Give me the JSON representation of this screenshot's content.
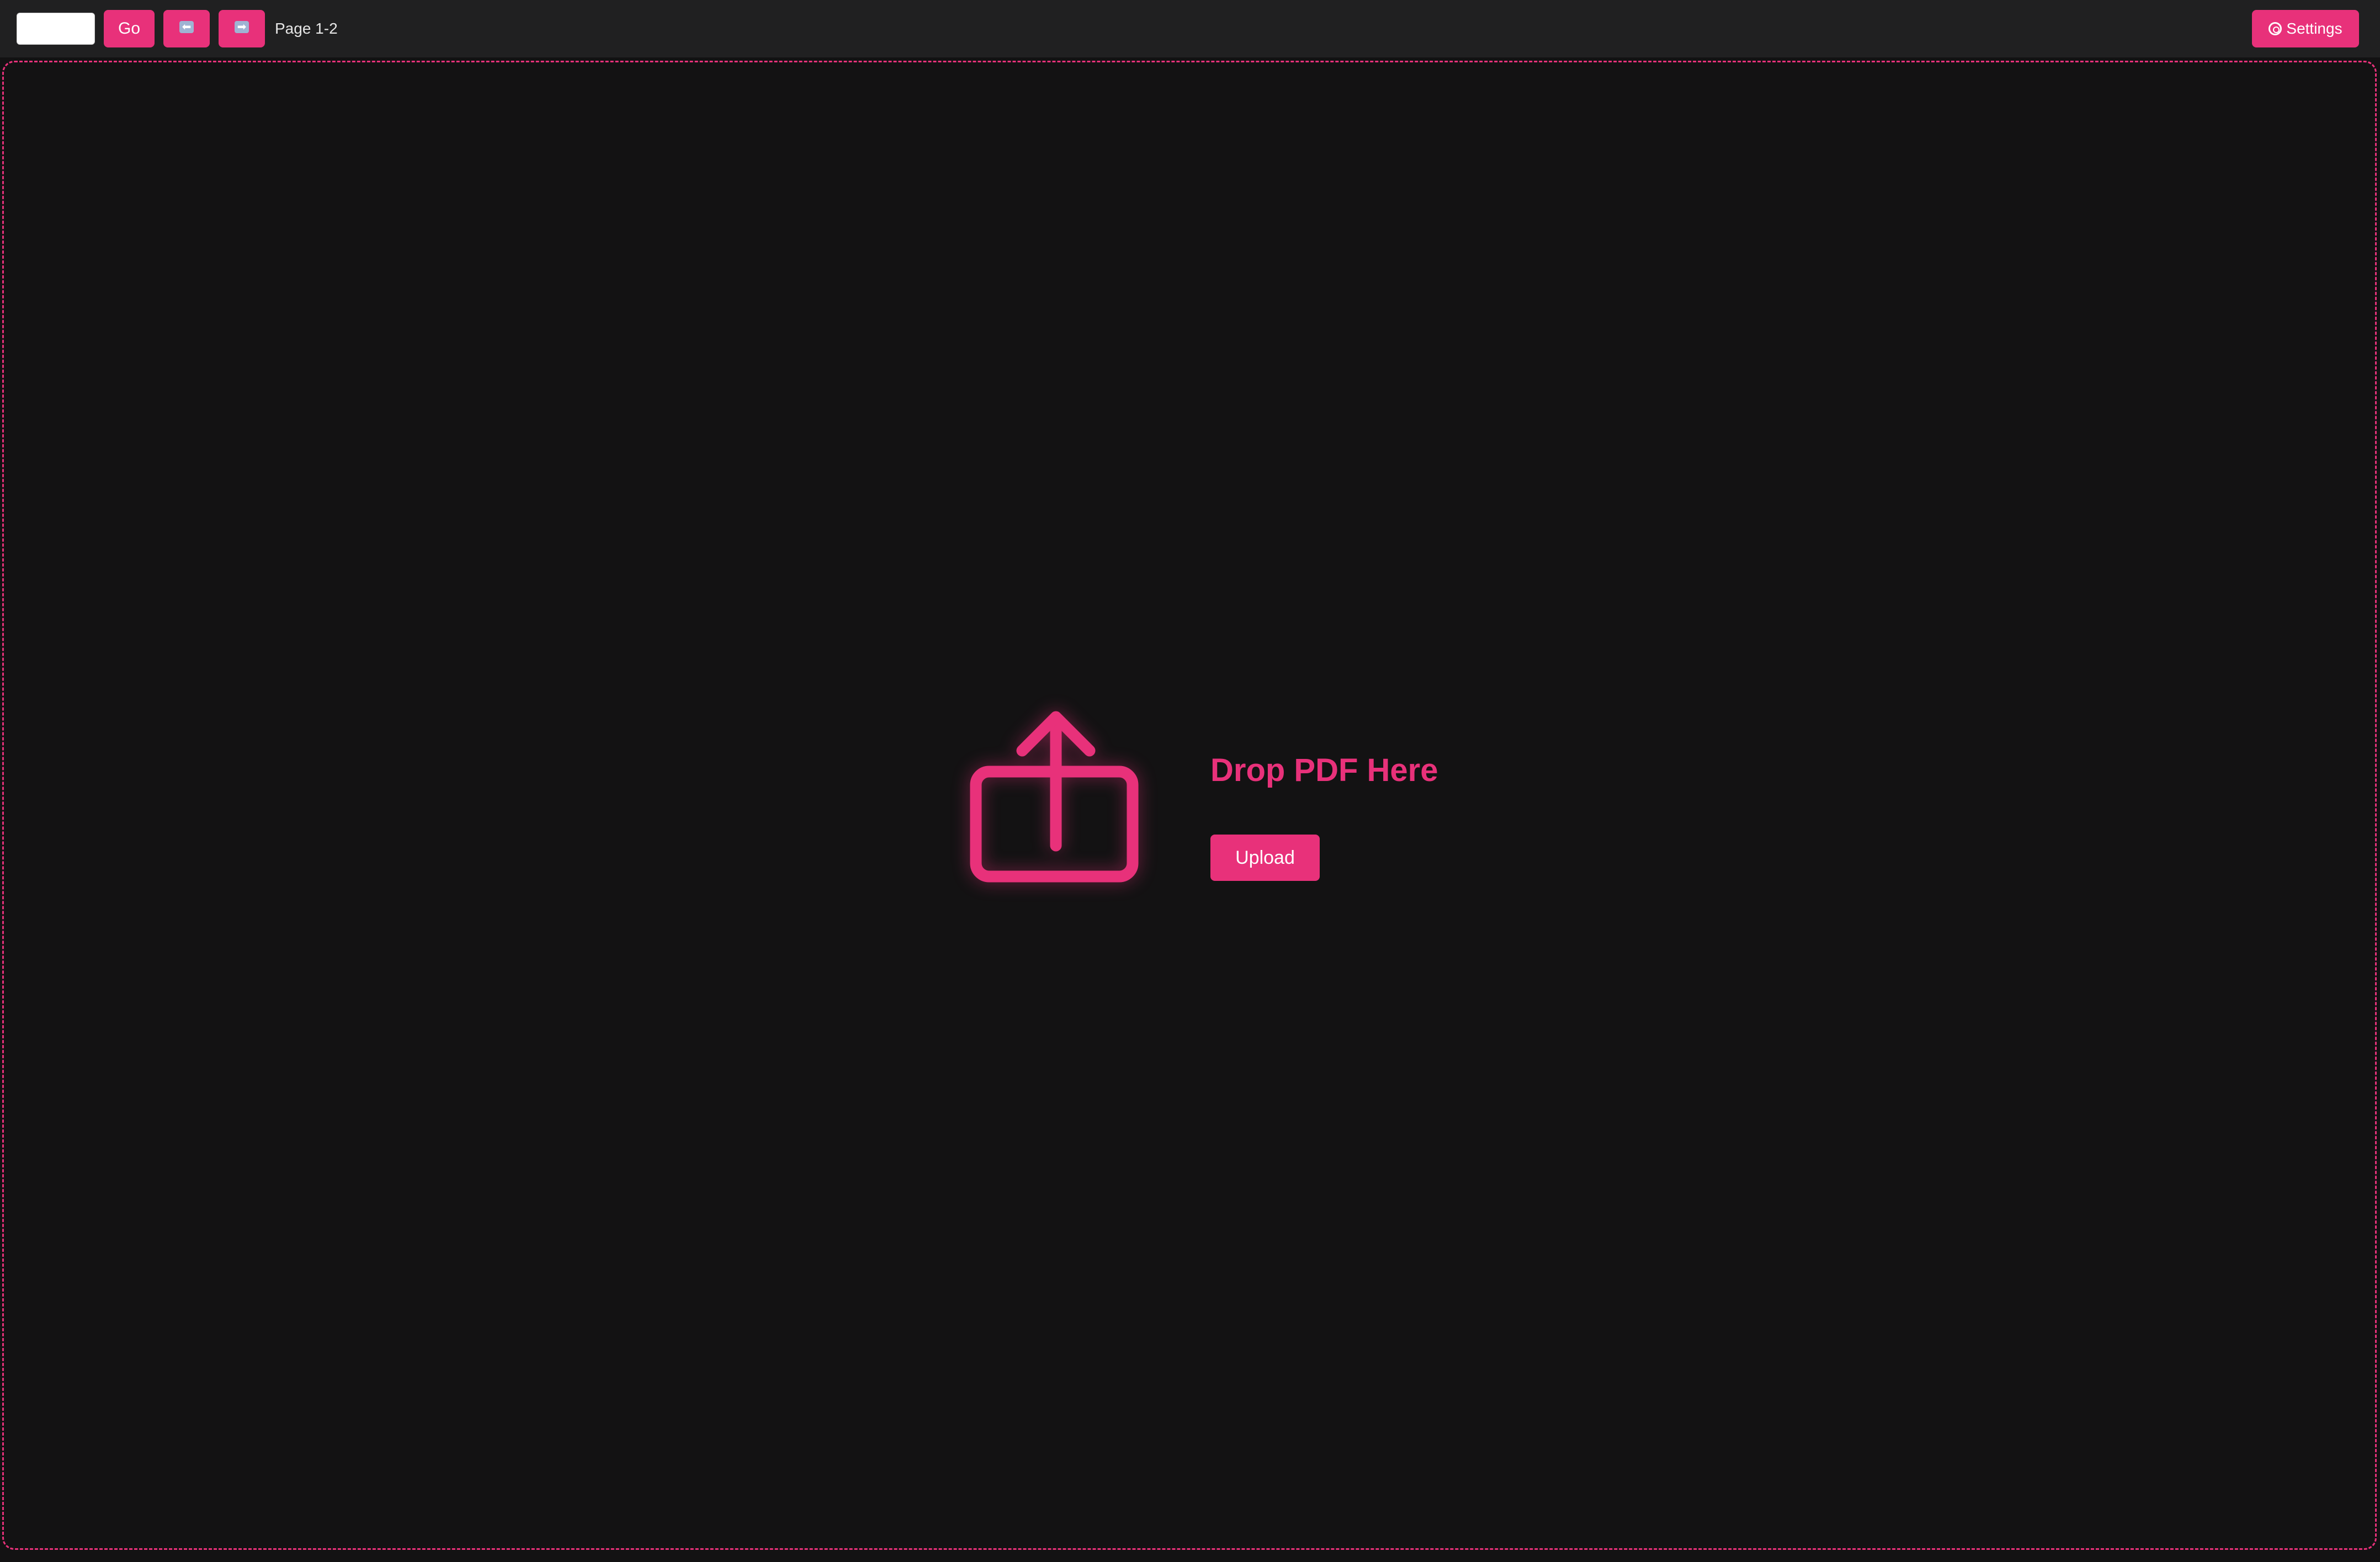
{
  "toolbar": {
    "page_input_value": "",
    "go_label": "Go",
    "prev_icon": "left-arrow-emoji-icon",
    "prev_glyph": "⬅",
    "next_icon": "right-arrow-emoji-icon",
    "next_glyph": "➡",
    "page_label": "Page 1-2",
    "settings_label": "Settings",
    "settings_icon": "gear-icon"
  },
  "dropzone": {
    "title": "Drop PDF Here",
    "upload_label": "Upload",
    "icon": "upload-icon"
  },
  "colors": {
    "accent": "#e8317a",
    "background": "#131213",
    "toolbar": "#202021"
  }
}
